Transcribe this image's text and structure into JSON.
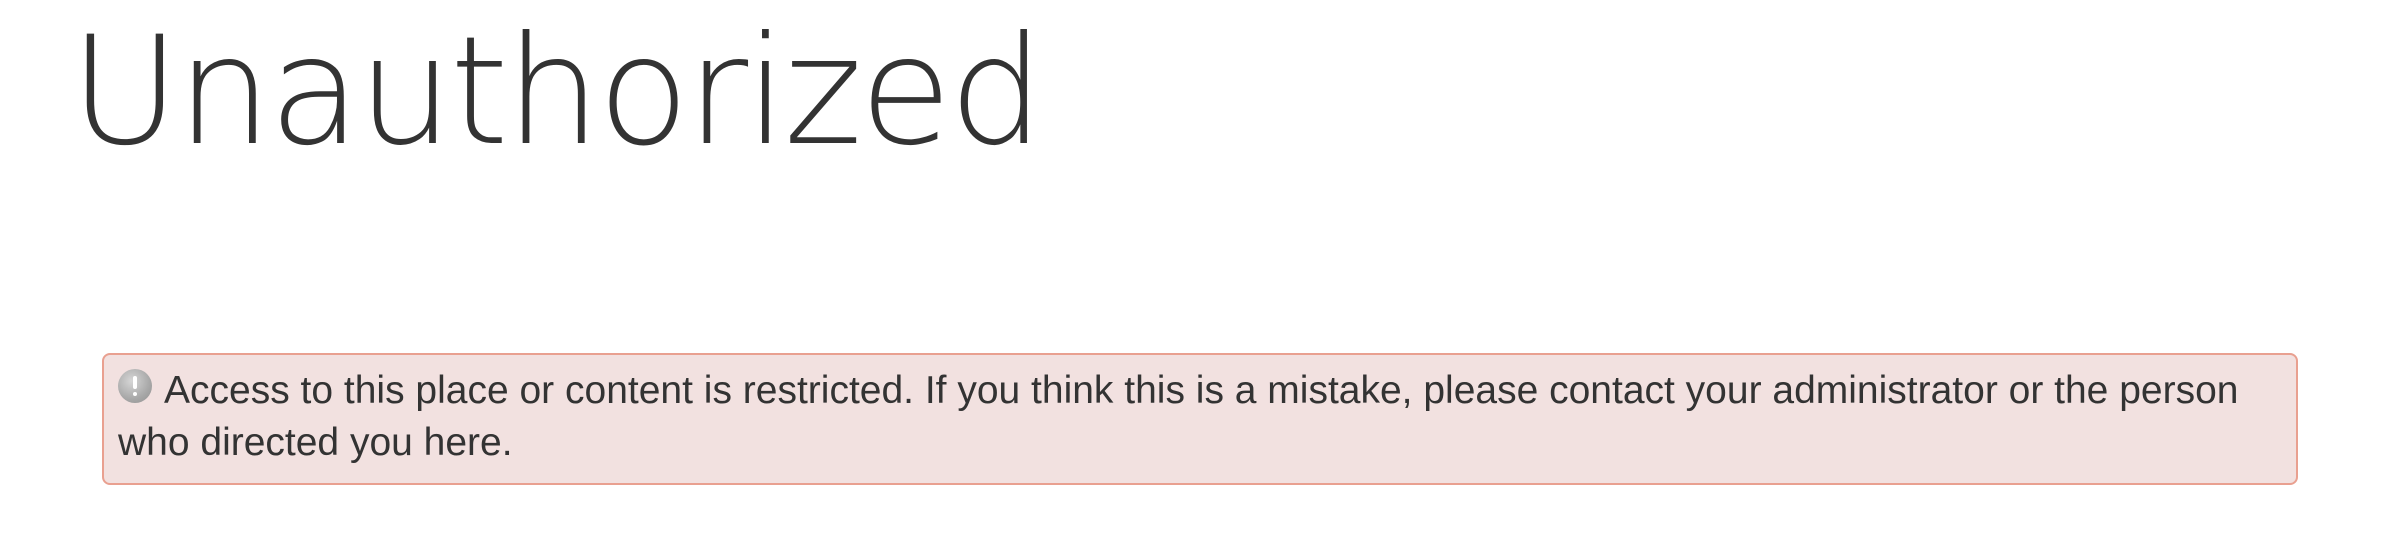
{
  "page": {
    "title": "Unauthorized"
  },
  "alert": {
    "icon": "warning-icon",
    "message": "Access to this place or content is restricted. If you think this is a mistake, please contact your administrator or the person who directed you here."
  },
  "colors": {
    "alert_background": "#f2e1e0",
    "alert_border": "#e9a090",
    "text": "#333333"
  }
}
